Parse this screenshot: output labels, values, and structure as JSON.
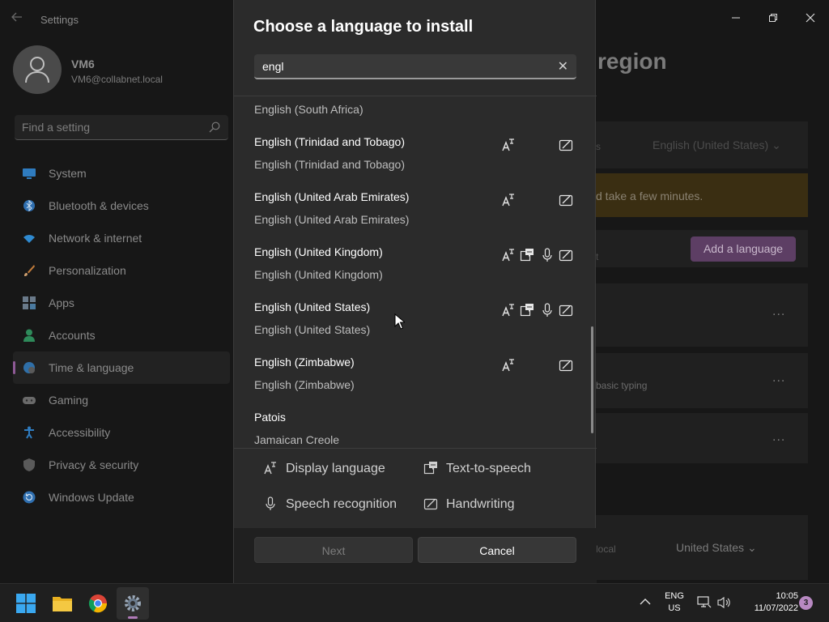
{
  "settings": {
    "app_title": "Settings",
    "back_icon": "arrow-left-icon",
    "user": {
      "name": "VM6",
      "email": "VM6@collabnet.local"
    },
    "search": {
      "placeholder": "Find a setting"
    },
    "nav": [
      {
        "label": "System",
        "icon": "monitor-icon",
        "color": "#2f8fd8"
      },
      {
        "label": "Bluetooth & devices",
        "icon": "bluetooth-icon",
        "color": "#2f8fd8"
      },
      {
        "label": "Network & internet",
        "icon": "wifi-icon",
        "color": "#3aa0e0"
      },
      {
        "label": "Personalization",
        "icon": "brush-icon",
        "color": "#d08a3a"
      },
      {
        "label": "Apps",
        "icon": "apps-icon",
        "color": "#6a8aa8"
      },
      {
        "label": "Accounts",
        "icon": "person-icon",
        "color": "#3aa06a"
      },
      {
        "label": "Time & language",
        "icon": "globe-clock-icon",
        "color": "#3a8ad0"
      },
      {
        "label": "Gaming",
        "icon": "gamepad-icon",
        "color": "#8a8a8a"
      },
      {
        "label": "Accessibility",
        "icon": "accessibility-icon",
        "color": "#3a8ad0"
      },
      {
        "label": "Privacy & security",
        "icon": "shield-icon",
        "color": "#7a7a7a"
      },
      {
        "label": "Windows Update",
        "icon": "refresh-icon",
        "color": "#2f8fd8"
      }
    ],
    "active_nav": "Time & language",
    "page_title_fragment": "region",
    "display_language_value": "English (United States)",
    "fragment_s": "s",
    "warning_text": "d take a few minutes.",
    "fragment_t": "t",
    "add_language_label": "Add a language",
    "basic_typing_fragment": "basic typing",
    "local_fragment": "local",
    "country_value": "United States",
    "more_label": "..."
  },
  "dialog": {
    "title": "Choose a language to install",
    "search_value": "engl",
    "clear_label": "✕",
    "languages": [
      {
        "name": "",
        "native": "English (South Africa)",
        "features": []
      },
      {
        "name": "English (Trinidad and Tobago)",
        "native": "English (Trinidad and Tobago)",
        "features": [
          "display",
          "handwriting"
        ]
      },
      {
        "name": "English (United Arab Emirates)",
        "native": "English (United Arab Emirates)",
        "features": [
          "display",
          "handwriting"
        ]
      },
      {
        "name": "English (United Kingdom)",
        "native": "English (United Kingdom)",
        "features": [
          "display",
          "tts",
          "speech",
          "handwriting"
        ]
      },
      {
        "name": "English (United States)",
        "native": "English (United States)",
        "features": [
          "display",
          "tts",
          "speech",
          "handwriting"
        ]
      },
      {
        "name": "English (Zimbabwe)",
        "native": "English (Zimbabwe)",
        "features": [
          "display",
          "handwriting"
        ]
      },
      {
        "name": "Patois",
        "native": "Jamaican Creole",
        "features": []
      }
    ],
    "legend": {
      "display": "Display language",
      "tts": "Text-to-speech",
      "speech": "Speech recognition",
      "handwriting": "Handwriting"
    },
    "next_label": "Next",
    "cancel_label": "Cancel"
  },
  "taskbar": {
    "apps": [
      "start-icon",
      "file-explorer-icon",
      "chrome-icon",
      "settings-gear-icon"
    ],
    "ime_line1": "ENG",
    "ime_line2": "US",
    "time": "10:05",
    "date": "11/07/2022",
    "notification_count": "3"
  }
}
